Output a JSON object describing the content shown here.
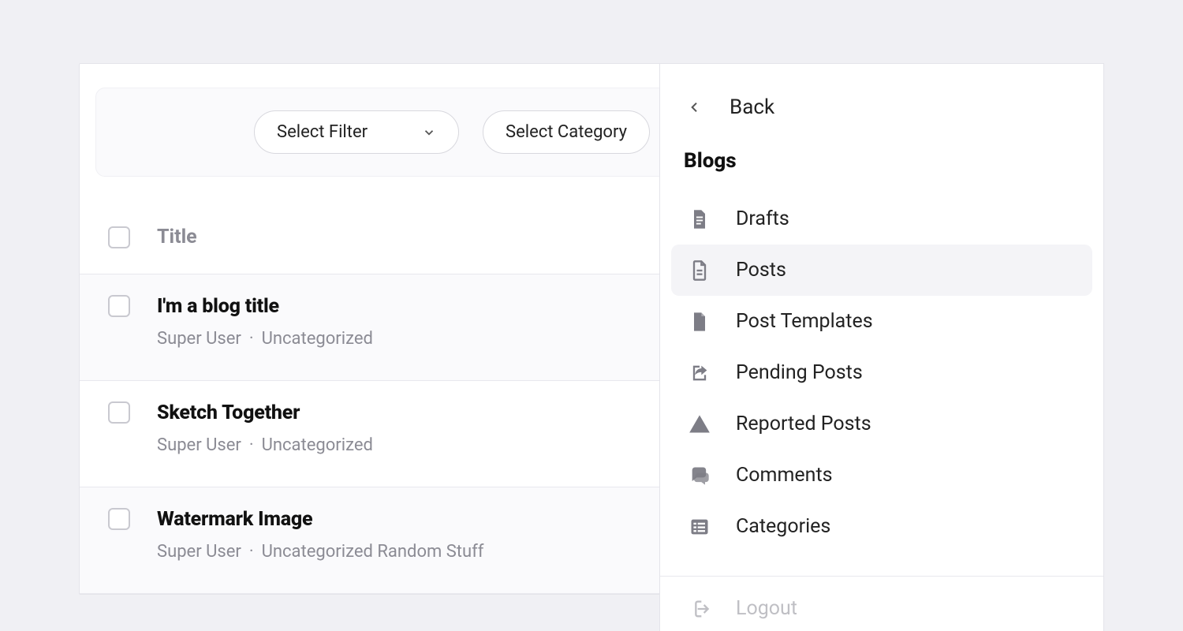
{
  "filters": {
    "filter_label": "Select Filter",
    "category_label": "Select Category"
  },
  "table": {
    "header_title": "Title",
    "rows": [
      {
        "title": "I'm a blog title",
        "author": "Super User",
        "category": "Uncategorized",
        "shaded": true
      },
      {
        "title": "Sketch Together",
        "author": "Super User",
        "category": "Uncategorized",
        "shaded": false
      },
      {
        "title": "Watermark Image",
        "author": "Super User",
        "category": "Uncategorized Random Stuff",
        "shaded": true
      }
    ]
  },
  "sidebar": {
    "back_label": "Back",
    "section_title": "Blogs",
    "items": [
      {
        "label": "Drafts",
        "icon": "document-icon",
        "active": false
      },
      {
        "label": "Posts",
        "icon": "post-icon",
        "active": true
      },
      {
        "label": "Post Templates",
        "icon": "file-icon",
        "active": false
      },
      {
        "label": "Pending Posts",
        "icon": "share-out-icon",
        "active": false
      },
      {
        "label": "Reported Posts",
        "icon": "warning-icon",
        "active": false
      },
      {
        "label": "Comments",
        "icon": "comments-icon",
        "active": false
      },
      {
        "label": "Categories",
        "icon": "list-icon",
        "active": false
      }
    ],
    "logout_label": "Logout"
  }
}
